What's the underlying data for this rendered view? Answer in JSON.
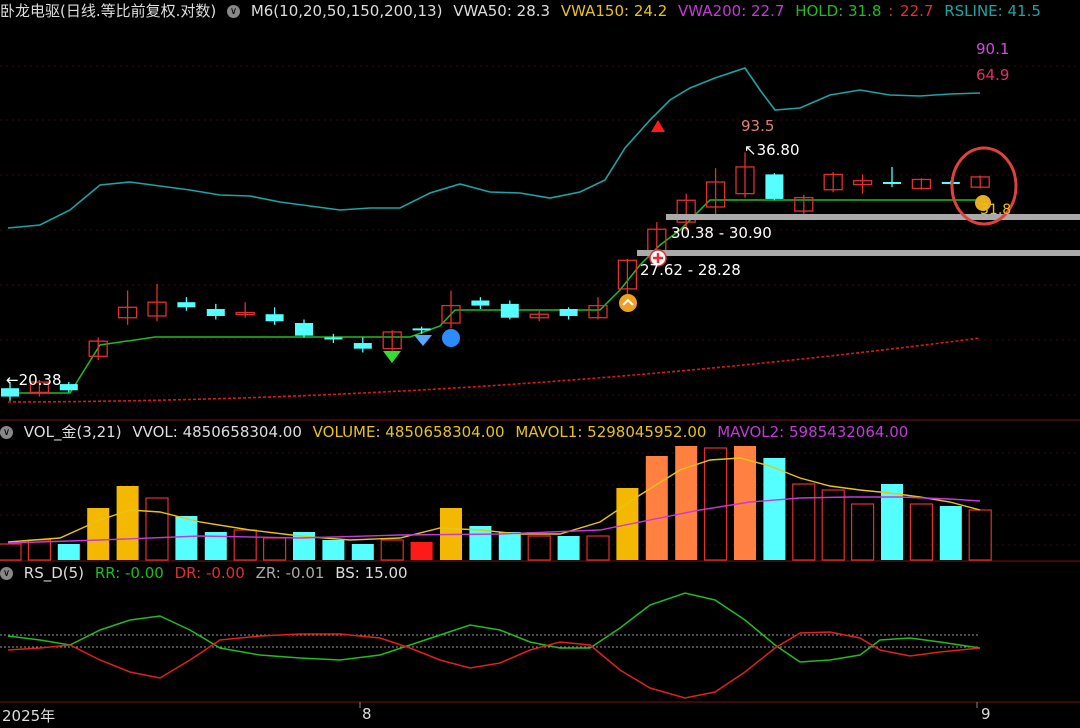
{
  "main_panel": {
    "title": "卧龙电驱(日线.等比前复权.对数)",
    "indicator": "M6(10,20,50,150,200,13)",
    "vwa50": "VWA50: 28.3",
    "vwa150": "VWA150: 24.2",
    "vwa200": "VWA200: 22.7",
    "hold": "HOLD: 31.8",
    "hold_sep": ":",
    "hold2": "22.7",
    "rsline": "RSLINE: 41.5",
    "right_label_1": "90.1",
    "right_label_2": "64.9",
    "peak_label": "93.5",
    "high_label": "36.80",
    "low_label": "20.38",
    "zone1_label": "30.38 - 30.90",
    "zone2_label": "27.62 - 28.28",
    "last_label": "31.8",
    "colors": {
      "rsline": "#1fa3a3",
      "hold": "#22bb22",
      "vwa200": "#d81a1a",
      "up": "#e03030",
      "down": "#55ffff"
    }
  },
  "volume_panel": {
    "title": "VOL_金(3,21)",
    "vvol": "VVOL: 4850658304.00",
    "volume": "VOLUME: 4850658304.00",
    "mavol1": "MAVOL1: 5298045952.00",
    "mavol2": "MAVOL2: 5985432064.00"
  },
  "rs_panel": {
    "title": "RS_D(5)",
    "rr": "RR: -0.00",
    "dr": "DR: -0.00",
    "zr": "ZR: -0.01",
    "bs": "BS: 15.00"
  },
  "x_axis": {
    "labels": [
      "2025年",
      "8",
      "9"
    ]
  },
  "chart_data": {
    "type": "candlestick",
    "candles": [
      {
        "o": 20.6,
        "c": 20.2,
        "h": 20.9,
        "l": 20.0
      },
      {
        "o": 20.4,
        "c": 20.9,
        "h": 21.0,
        "l": 20.2
      },
      {
        "o": 20.8,
        "c": 20.5,
        "h": 20.9,
        "l": 20.4
      },
      {
        "o": 22.2,
        "c": 23.0,
        "h": 23.2,
        "l": 22.0
      },
      {
        "o": 24.3,
        "c": 24.9,
        "h": 25.9,
        "l": 23.9
      },
      {
        "o": 24.4,
        "c": 25.2,
        "h": 26.3,
        "l": 24.1
      },
      {
        "o": 25.2,
        "c": 24.9,
        "h": 25.5,
        "l": 24.7
      },
      {
        "o": 24.8,
        "c": 24.4,
        "h": 25.1,
        "l": 24.2
      },
      {
        "o": 24.5,
        "c": 24.6,
        "h": 25.2,
        "l": 24.3
      },
      {
        "o": 24.5,
        "c": 24.1,
        "h": 24.9,
        "l": 23.9
      },
      {
        "o": 24.0,
        "c": 23.3,
        "h": 24.2,
        "l": 23.2
      },
      {
        "o": 23.2,
        "c": 23.15,
        "h": 23.4,
        "l": 22.9
      },
      {
        "o": 22.9,
        "c": 22.6,
        "h": 23.2,
        "l": 22.4
      },
      {
        "o": 22.6,
        "c": 23.5,
        "h": 23.6,
        "l": 22.5
      },
      {
        "o": 23.7,
        "c": 23.6,
        "h": 23.8,
        "l": 23.4
      },
      {
        "o": 24.0,
        "c": 25.0,
        "h": 25.9,
        "l": 23.7
      },
      {
        "o": 25.3,
        "c": 25.0,
        "h": 25.5,
        "l": 24.8
      },
      {
        "o": 25.1,
        "c": 24.3,
        "h": 25.3,
        "l": 24.2
      },
      {
        "o": 24.3,
        "c": 24.5,
        "h": 24.8,
        "l": 24.1
      },
      {
        "o": 24.8,
        "c": 24.4,
        "h": 24.9,
        "l": 24.2
      },
      {
        "o": 24.3,
        "c": 25.0,
        "h": 25.5,
        "l": 24.2
      },
      {
        "o": 26.0,
        "c": 27.8,
        "h": 27.9,
        "l": 25.5
      },
      {
        "o": 28.0,
        "c": 29.9,
        "h": 30.4,
        "l": 27.5
      },
      {
        "o": 30.4,
        "c": 32.0,
        "h": 32.5,
        "l": 29.8
      },
      {
        "o": 31.5,
        "c": 33.4,
        "h": 34.5,
        "l": 30.9
      },
      {
        "o": 32.5,
        "c": 34.6,
        "h": 35.8,
        "l": 32.2
      },
      {
        "o": 34.0,
        "c": 32.1,
        "h": 34.1,
        "l": 32.0
      },
      {
        "o": 31.2,
        "c": 32.2,
        "h": 32.4,
        "l": 31.0
      },
      {
        "o": 32.8,
        "c": 34.0,
        "h": 34.2,
        "l": 32.6
      },
      {
        "o": 33.2,
        "c": 33.5,
        "h": 34.0,
        "l": 32.5
      },
      {
        "o": 33.4,
        "c": 33.3,
        "h": 34.6,
        "l": 33.0
      },
      {
        "o": 32.9,
        "c": 33.6,
        "h": 33.7,
        "l": 32.8
      },
      {
        "o": 33.4,
        "c": 33.3,
        "h": 33.5,
        "l": 33.2
      },
      {
        "o": 33.0,
        "c": 33.8,
        "h": 33.9,
        "l": 32.9
      }
    ],
    "volume_bars": [
      {
        "v": 0.8,
        "k": "b"
      },
      {
        "v": 1.0,
        "k": "b"
      },
      {
        "v": 0.8,
        "k": "c"
      },
      {
        "v": 2.6,
        "k": "y"
      },
      {
        "v": 3.7,
        "k": "y"
      },
      {
        "v": 3.1,
        "k": "r"
      },
      {
        "v": 2.2,
        "k": "c"
      },
      {
        "v": 1.4,
        "k": "c"
      },
      {
        "v": 1.5,
        "k": "r"
      },
      {
        "v": 1.1,
        "k": "r"
      },
      {
        "v": 1.4,
        "k": "c"
      },
      {
        "v": 1.0,
        "k": "c"
      },
      {
        "v": 0.8,
        "k": "c"
      },
      {
        "v": 1.0,
        "k": "r"
      },
      {
        "v": 0.9,
        "k": "rf"
      },
      {
        "v": 2.6,
        "k": "y"
      },
      {
        "v": 1.7,
        "k": "c"
      },
      {
        "v": 1.4,
        "k": "c"
      },
      {
        "v": 1.2,
        "k": "r"
      },
      {
        "v": 1.2,
        "k": "c"
      },
      {
        "v": 1.2,
        "k": "r"
      },
      {
        "v": 3.6,
        "k": "y"
      },
      {
        "v": 5.2,
        "k": "o"
      },
      {
        "v": 5.7,
        "k": "o"
      },
      {
        "v": 5.6,
        "k": "r"
      },
      {
        "v": 5.7,
        "k": "o"
      },
      {
        "v": 5.1,
        "k": "c"
      },
      {
        "v": 3.8,
        "k": "r"
      },
      {
        "v": 3.5,
        "k": "r"
      },
      {
        "v": 2.8,
        "k": "r"
      },
      {
        "v": 3.8,
        "k": "c"
      },
      {
        "v": 2.8,
        "k": "r"
      },
      {
        "v": 2.7,
        "k": "c"
      },
      {
        "v": 2.5,
        "k": "r"
      }
    ]
  }
}
